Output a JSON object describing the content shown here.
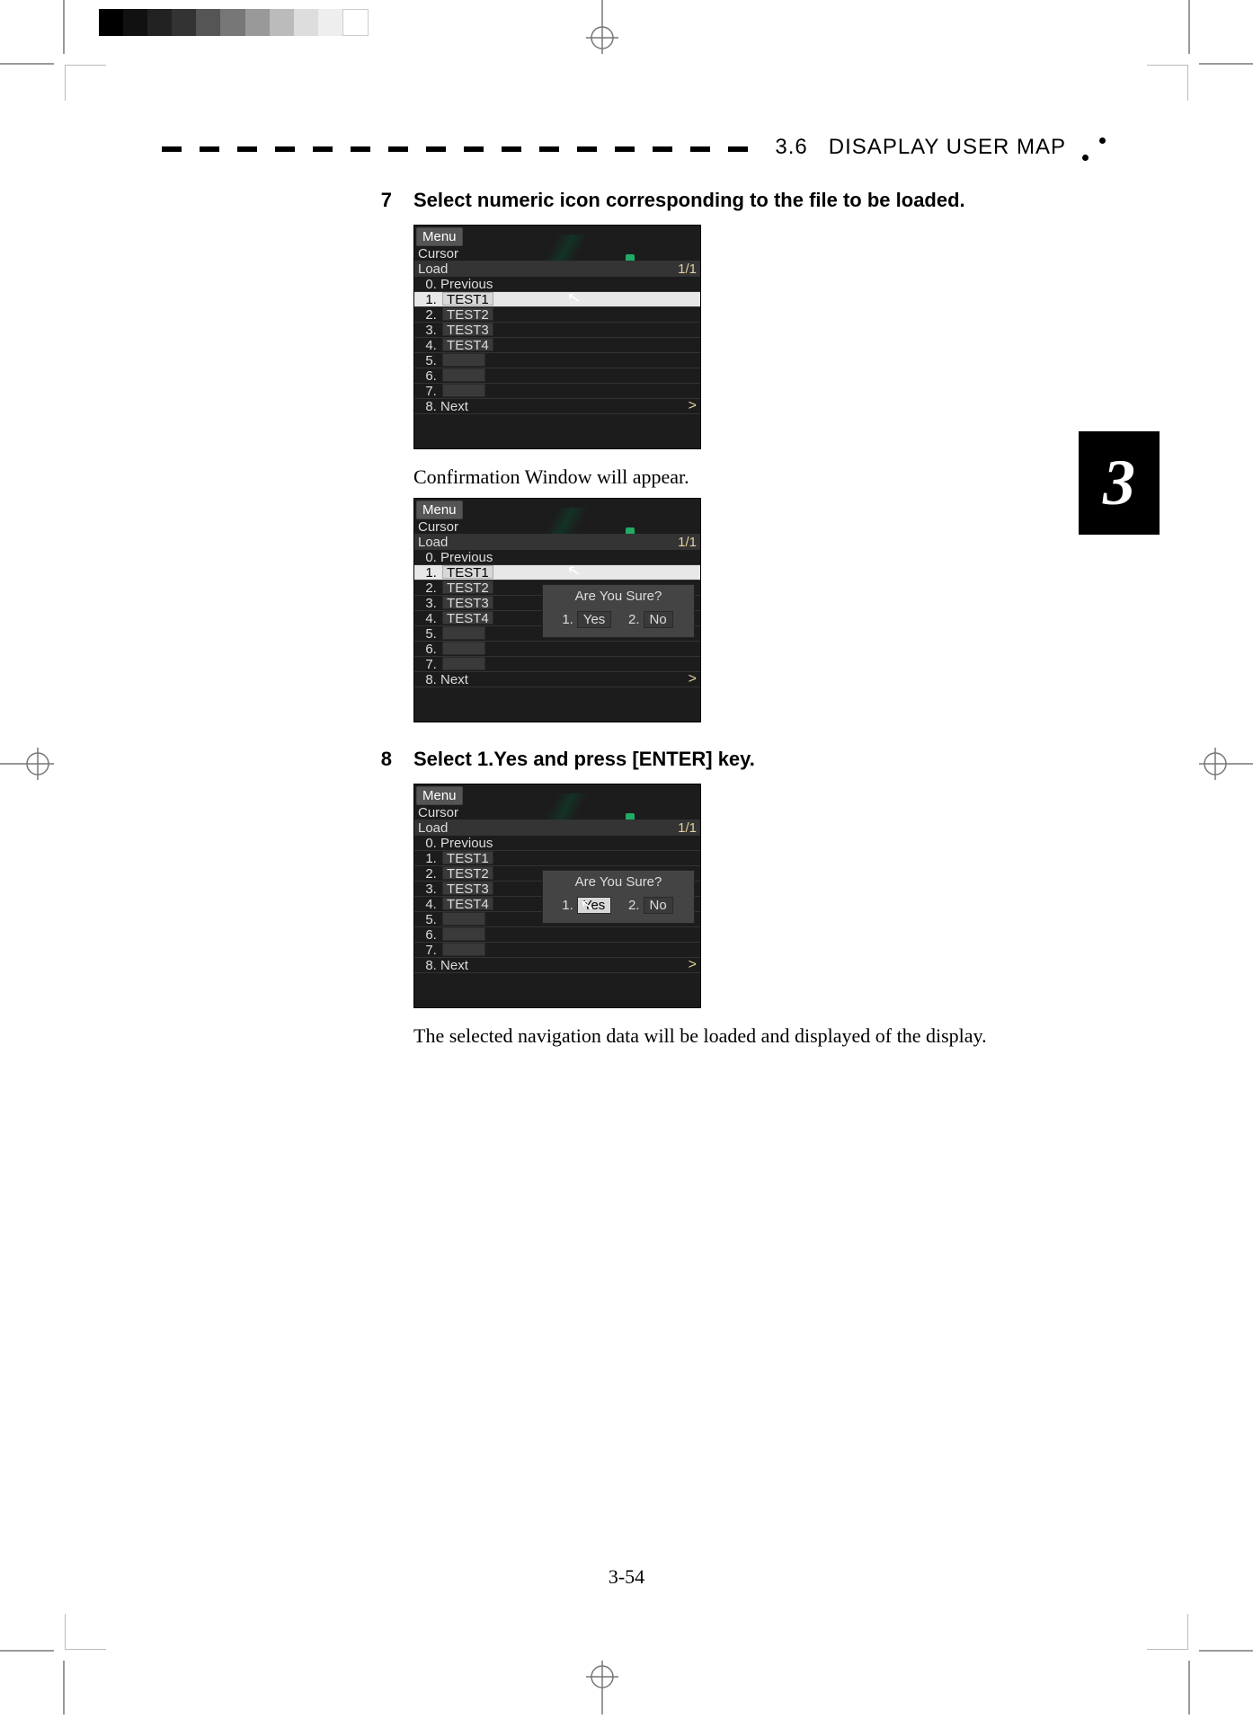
{
  "header": {
    "section_number": "3.6",
    "section_title": "DISAPLAY  USER  MAP",
    "chapter_tab": "3"
  },
  "steps": {
    "s7": {
      "num": "7",
      "text": "Select numeric icon corresponding to the file to be loaded."
    },
    "s7_after": "Confirmation Window will appear.",
    "s8": {
      "num": "8",
      "text": "Select    1.Yes and press [ENTER] key."
    },
    "s8_after": "The selected navigation data will be loaded and displayed of the display."
  },
  "shot1": {
    "menu": "Menu",
    "cursor": "Cursor",
    "load": "Load",
    "page": "1/1",
    "r0": "0. Previous",
    "r1n": "1.",
    "r1v": "TEST1",
    "r2n": "2.",
    "r2v": "TEST2",
    "r3n": "3.",
    "r3v": "TEST3",
    "r4n": "4.",
    "r4v": "TEST4",
    "r5": "5.",
    "r6": "6.",
    "r7": "7.",
    "r8": "8. Next"
  },
  "shot2": {
    "menu": "Menu",
    "cursor": "Cursor",
    "load": "Load",
    "page": "1/1",
    "r0": "0. Previous",
    "r1n": "1.",
    "r1v": "TEST1",
    "r2n": "2.",
    "r2v": "TEST2",
    "r3n": "3.",
    "r3v": "TEST3",
    "r4n": "4.",
    "r4v": "TEST4",
    "r5": "5.",
    "r6": "6.",
    "r7": "7.",
    "r8": "8. Next",
    "popup_q": "Are You Sure?",
    "p1n": "1.",
    "p1v": "Yes",
    "p2n": "2.",
    "p2v": "No"
  },
  "shot3": {
    "menu": "Menu",
    "cursor": "Cursor",
    "load": "Load",
    "page": "1/1",
    "r0": "0. Previous",
    "r1n": "1.",
    "r1v": "TEST1",
    "r2n": "2.",
    "r2v": "TEST2",
    "r3n": "3.",
    "r3v": "TEST3",
    "r4n": "4.",
    "r4v": "TEST4",
    "r5": "5.",
    "r6": "6.",
    "r7": "7.",
    "r8": "8. Next",
    "popup_q": "Are You Sure?",
    "p1n": "1.",
    "p1v": "Yes",
    "p2n": "2.",
    "p2v": "No"
  },
  "page_number": "3-54"
}
